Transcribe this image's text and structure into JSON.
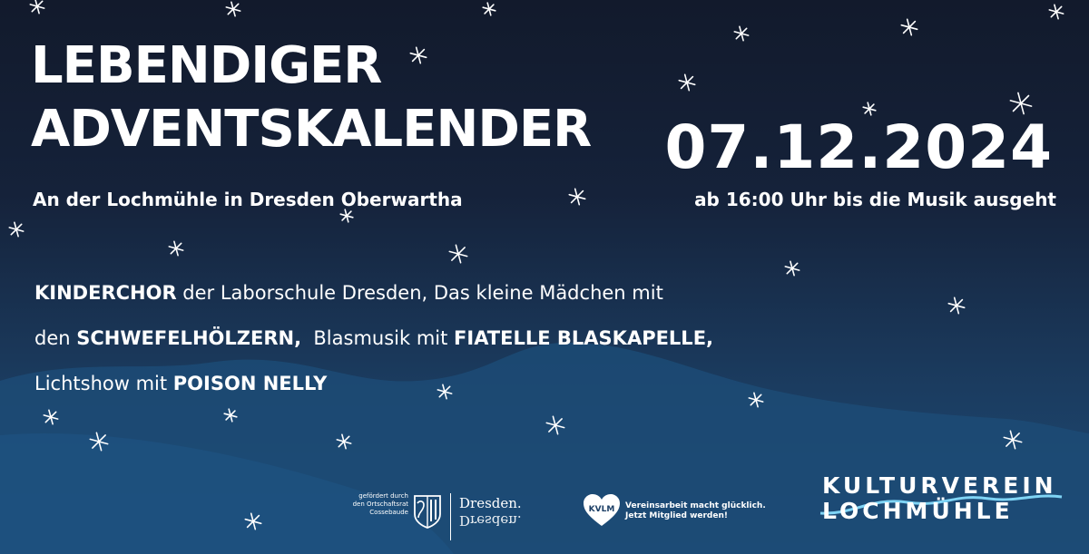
{
  "event": {
    "title_line1": "LEBENDIGER",
    "title_line2": "ADVENTSKALENDER",
    "location": "An der Lochmühle in Dresden Oberwartha",
    "date": "07.12.2024",
    "time": "ab 16:00 Uhr bis die Musik ausgeht"
  },
  "lineup": {
    "act1": "KINDERCHOR",
    "text1": " der Laborschule Dresden, Das kleine Mädchen mit",
    "text2": "den ",
    "act2": "SCHWEFELHÖLZERN,",
    "text3": "  Blasmusik mit ",
    "act3": "FIATELLE BLASKAPELLE,",
    "text4": "Lichtshow mit ",
    "act4": "POISON NELLY"
  },
  "sponsors": {
    "funding_line1": "gefördert durch",
    "funding_line2": "den Ortschaftsrat",
    "funding_line3": "Cossebaude",
    "city_logo": "Dresden.",
    "city_logo_mirror": "Dresden.",
    "kvlm_badge": "KVLM",
    "kvlm_line1": "Vereinsarbeit macht glücklich.",
    "kvlm_line2": "Jetzt Mitglied werden!"
  },
  "organizer": {
    "line1": "KULTURVEREIN",
    "line2": "LOCHMÜHLE"
  },
  "colors": {
    "background_top": "#121a2c",
    "background_bottom": "#1d4c78",
    "hill": "#1c4a74",
    "text": "#ffffff",
    "wave": "#7fd4f5"
  },
  "icons": {
    "stars": "sparkle-star-icon",
    "crest": "dresden-crest-icon",
    "heart": "heart-icon"
  }
}
